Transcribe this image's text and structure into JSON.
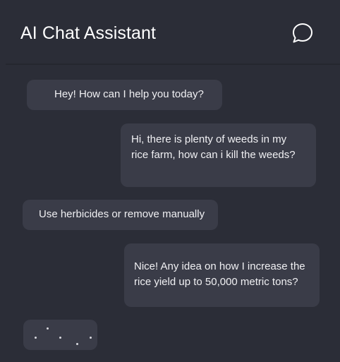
{
  "header": {
    "title": "AI Chat Assistant",
    "icon": "chat-bubble-icon"
  },
  "messages": [
    {
      "sender": "assistant",
      "text": "Hey! How can I help you today?"
    },
    {
      "sender": "user",
      "text": "Hi, there is plenty of weeds in my rice farm, how can i kill the weeds?"
    },
    {
      "sender": "assistant",
      "text": "Use herbicides or remove manually"
    },
    {
      "sender": "user",
      "text": "Nice! Any idea on how I increase the rice yield up to 50,000 metric tons?"
    }
  ],
  "typing_indicator": {
    "visible": true
  },
  "colors": {
    "background": "#2b2d37",
    "bubble": "#3a3c48",
    "text": "#f0f0f3"
  }
}
